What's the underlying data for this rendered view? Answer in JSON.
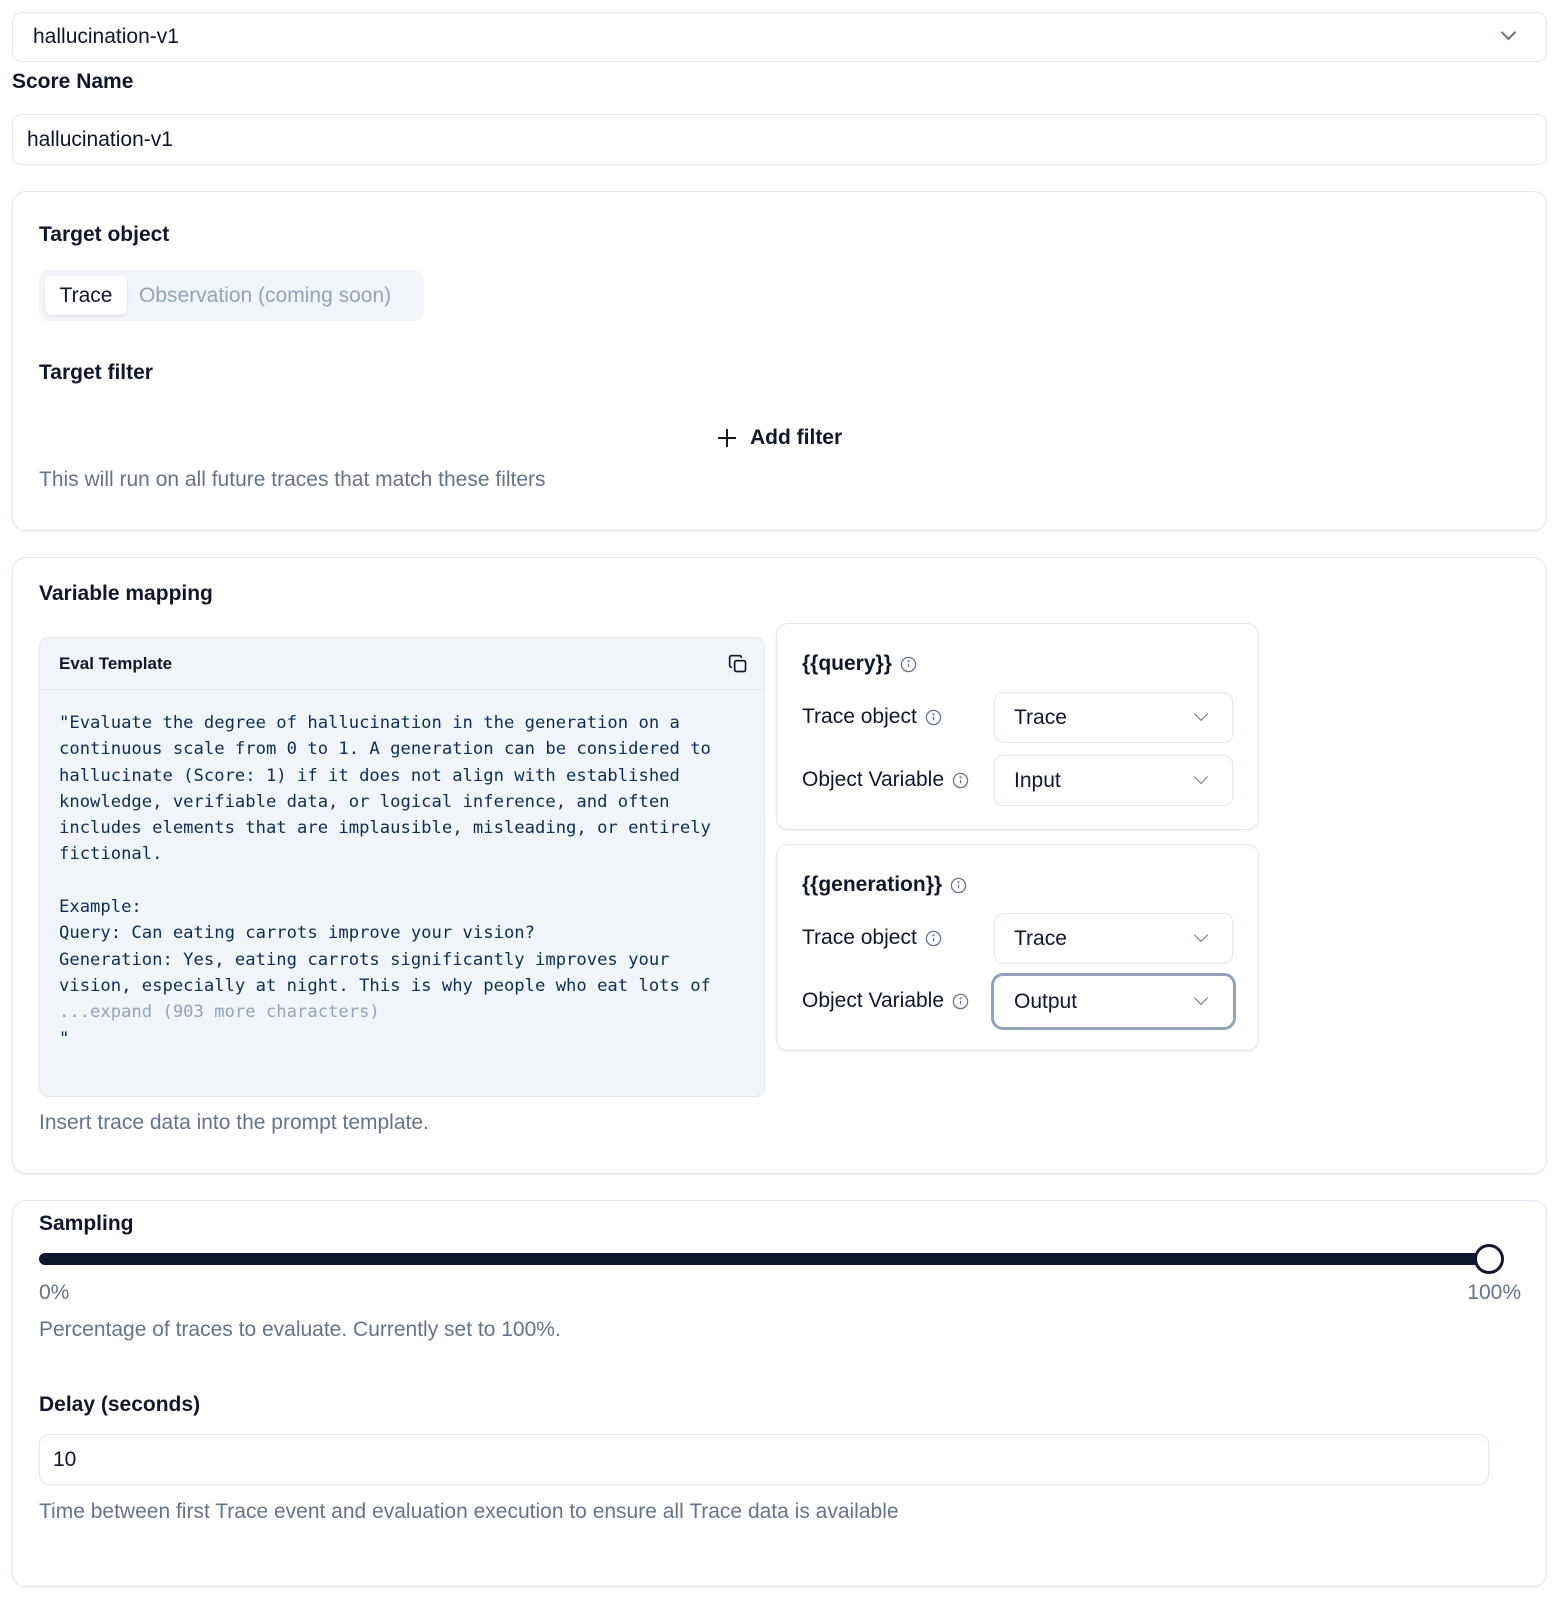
{
  "template_select": {
    "value": "hallucination-v1"
  },
  "score_name": {
    "label": "Score Name",
    "value": "hallucination-v1"
  },
  "target": {
    "object_label": "Target object",
    "tabs": [
      {
        "label": "Trace",
        "active": true
      },
      {
        "label": "Observation (coming soon)",
        "active": false,
        "disabled": true
      }
    ],
    "filter_label": "Target filter",
    "add_filter_label": "Add filter",
    "filter_hint": "This will run on all future traces that match these filters"
  },
  "variable_mapping": {
    "title": "Variable mapping",
    "template": {
      "header": "Eval Template",
      "text": "\"Evaluate the degree of hallucination in the generation on a continuous scale from 0 to 1. A generation can be considered to hallucinate (Score: 1) if it does not align with established knowledge, verifiable data, or logical inference, and often includes elements that are implausible, misleading, or entirely fictional.\n\nExample:\nQuery: Can eating carrots improve your vision?\nGeneration: Yes, eating carrots significantly improves your vision, especially at night. This is why people who eat lots of\n",
      "expand_label": "...expand (903 more characters)",
      "closing_quote": "\""
    },
    "variables": [
      {
        "name": "{{query}}",
        "trace_object_label": "Trace object",
        "trace_object_value": "Trace",
        "object_variable_label": "Object Variable",
        "object_variable_value": "Input"
      },
      {
        "name": "{{generation}}",
        "trace_object_label": "Trace object",
        "trace_object_value": "Trace",
        "object_variable_label": "Object Variable",
        "object_variable_value": "Output"
      }
    ],
    "hint": "Insert trace data into the prompt template."
  },
  "sampling": {
    "title": "Sampling",
    "value_percent": 100,
    "min_label": "0%",
    "max_label": "100%",
    "hint": "Percentage of traces to evaluate. Currently set to 100%."
  },
  "delay": {
    "title": "Delay (seconds)",
    "value": "10",
    "hint": "Time between first Trace event and evaluation execution to ensure all Trace data is available"
  }
}
